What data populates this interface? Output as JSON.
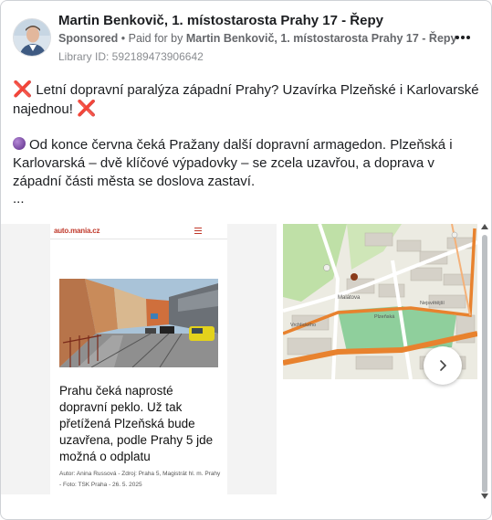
{
  "post": {
    "author": "Martin Benkovič, 1. místostarosta Prahy 17 - Řepy",
    "sponsored": "Sponsored",
    "paid_prefix": " • Paid for by ",
    "paid_by": "Martin Benkovič, 1. místostarosta Prahy 17 - Řepy",
    "library_id": "Library ID: 592189473906642",
    "text": {
      "line1_emoji": "❌",
      "line1": " Letní dopravní paralýza západní Prahy? Uzavírka Plzeňské i Karlovarské najednou! ",
      "line1_emoji_end": "❌",
      "line2": "Od konce června čeká Pražany další dopravní armagedon. Plzeňská i Karlovarská – dvě klíčové výpadovky – se zcela uzavřou, a doprava v západní části města se doslova zastaví.",
      "more": "..."
    }
  },
  "carousel": {
    "slide1": {
      "site_logo": "auto.mania.cz",
      "article_title": "Prahu čeká naprosté dopravní peklo. Už tak přetížená Plzeňská bude uzavřena, podle Prahy 5 jde možná o odplatu",
      "article_meta": "Autor: Anina Russová - Zdroj: Praha 5, Magistrát hl. m. Prahy - Foto: TSK Praha - 26. 5. 2025"
    },
    "slide2": {
      "map_labels": [
        "Malátova",
        "Nejsvětější",
        "Plzeňská",
        "Vrchlického"
      ]
    },
    "next_icon": "chevron-right-icon"
  },
  "colors": {
    "text": "#1c1e21",
    "secondary": "#65676b",
    "map_road_orange": "#e8822e",
    "map_green": "#8fcf9c"
  }
}
